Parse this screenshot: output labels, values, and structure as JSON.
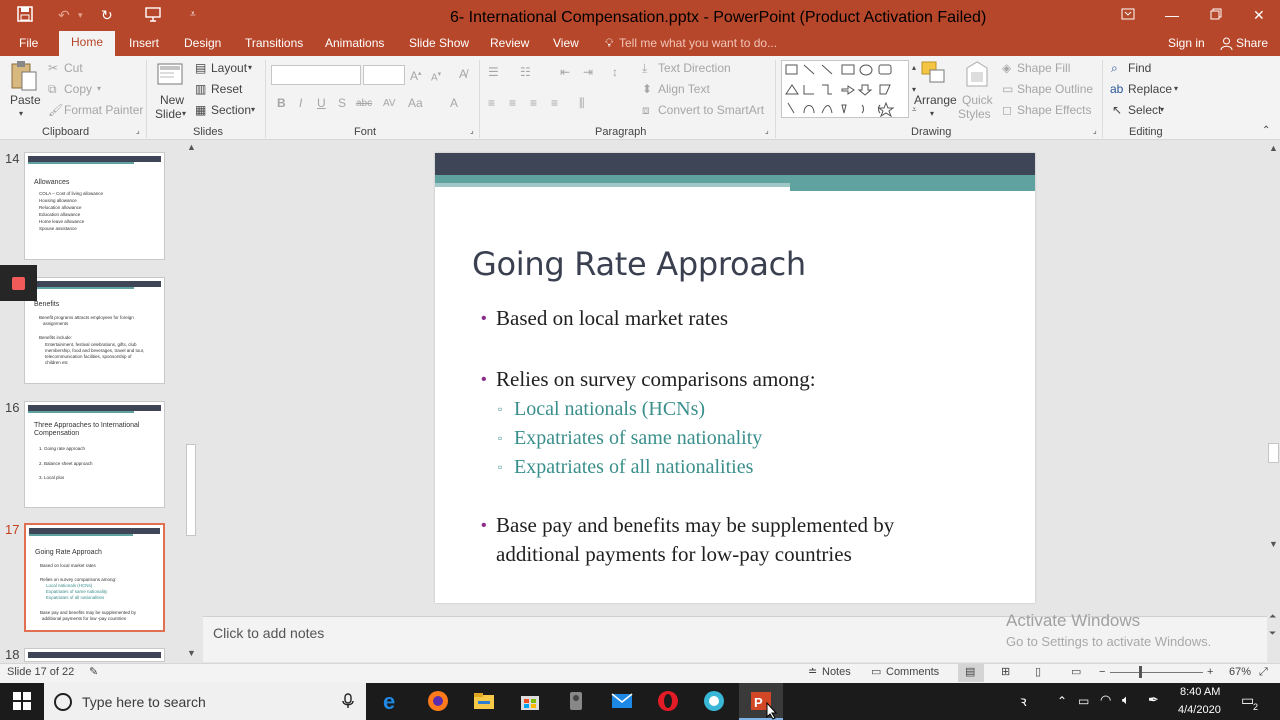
{
  "window": {
    "title": "6- International Compensation.pptx - PowerPoint (Product Activation Failed)",
    "sign_in": "Sign in",
    "share": "Share"
  },
  "tabs": [
    "File",
    "Home",
    "Insert",
    "Design",
    "Transitions",
    "Animations",
    "Slide Show",
    "Review",
    "View"
  ],
  "tell_me": "Tell me what you want to do...",
  "ribbon": {
    "clipboard": {
      "paste": "Paste",
      "cut": "Cut",
      "copy": "Copy",
      "format_painter": "Format Painter",
      "label": "Clipboard"
    },
    "slides": {
      "new_slide_1": "New",
      "new_slide_2": "Slide",
      "layout": "Layout",
      "reset": "Reset",
      "section": "Section",
      "label": "Slides"
    },
    "font": {
      "label": "Font"
    },
    "paragraph": {
      "text_direction": "Text Direction",
      "align_text": "Align Text",
      "convert_smartart": "Convert to SmartArt",
      "label": "Paragraph"
    },
    "drawing": {
      "arrange": "Arrange",
      "quick_styles_1": "Quick",
      "quick_styles_2": "Styles",
      "shape_fill": "Shape Fill",
      "shape_outline": "Shape Outline",
      "shape_effects": "Shape Effects",
      "label": "Drawing"
    },
    "editing": {
      "find": "Find",
      "replace": "Replace",
      "select": "Select",
      "label": "Editing"
    }
  },
  "thumbnails": [
    {
      "num": "14",
      "title": "Allowances",
      "lines": [
        "COLA – Cost of living allowance",
        "Housing allowance",
        "Relocation allowance",
        "Education allowance",
        "Home leave allowance",
        "Spouse assistance"
      ]
    },
    {
      "num": "",
      "title": "Benefits",
      "lines": [
        "Benefit programs attracts employees for foreign",
        "assignments",
        "Benefits include:",
        "Entertainment, festival celebrations, gifts, club",
        "membership, food and beverages, travel and tour,",
        "telecommunication facilities, sponsorship of",
        "children etc"
      ]
    },
    {
      "num": "16",
      "title": "Three Approaches to International Compensation",
      "lines": [
        "1.  Going rate approach",
        "2.  Balance sheet approach",
        "3.  Local plus"
      ]
    },
    {
      "num": "17",
      "title": "Going Rate Approach",
      "lines": [
        "Based on local market rates",
        "Relies on survey comparisons among:",
        "Local nationals (HCNs)",
        "Expatriates of same nationality",
        "Expatriates of all nationalities",
        "Base pay and benefits may be supplemented by",
        "additional payments for low -pay countries"
      ]
    },
    {
      "num": "18",
      "title": "",
      "lines": []
    }
  ],
  "slide": {
    "title": "Going Rate Approach",
    "bullet1": "Based on local market rates",
    "bullet2": "Relies on survey comparisons among:",
    "sub1": "Local nationals (HCNs)",
    "sub2": "Expatriates of same nationality",
    "sub3": "Expatriates of all nationalities",
    "bullet3a": "Base pay and benefits may be supplemented by",
    "bullet3b": "additional payments for low-pay countries"
  },
  "notes_placeholder": "Click to add notes",
  "activate": {
    "line1": "Activate Windows",
    "line2": "Go to Settings to activate Windows."
  },
  "status": {
    "slide_of": "Slide 17 of 22",
    "notes": "Notes",
    "comments": "Comments",
    "zoom": "67%"
  },
  "taskbar": {
    "search": "Type here to search",
    "time": "8:40 AM",
    "date": "4/4/2020",
    "notif": "2"
  },
  "colors": {
    "accent": "#b7472a",
    "slide_dark": "#3d4557",
    "slide_teal": "#5fa2a0",
    "bullet": "#8a2f8a",
    "sub_text": "#3a8f8c"
  }
}
